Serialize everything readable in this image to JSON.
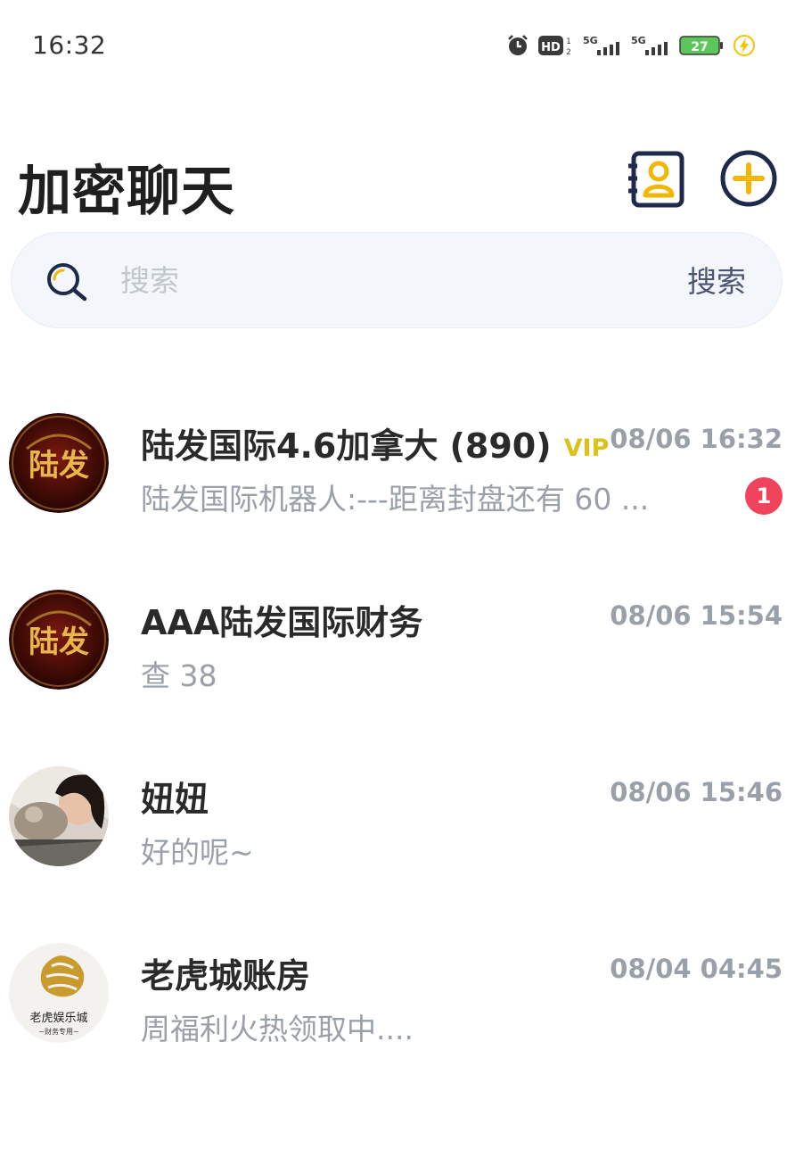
{
  "status_bar": {
    "time": "16:32",
    "icons": [
      "alarm-icon",
      "hd-icon",
      "signal-5g-icon",
      "signal-5g-icon",
      "battery-icon",
      "charging-icon"
    ],
    "hd_label": "HD",
    "network1": "5G",
    "network2": "5G",
    "battery_level": "27",
    "colors": {
      "battery": "#5dc65a",
      "charging": "#f5c400"
    }
  },
  "header": {
    "title": "加密聊天",
    "icons": [
      "contacts-icon",
      "add-icon"
    ],
    "colors": {
      "icon_frame": "#1e2a4a",
      "icon_accent": "#f2b705"
    }
  },
  "search": {
    "placeholder": "搜索",
    "button_label": "搜索",
    "icon": "search-icon"
  },
  "chats": [
    {
      "name": "陆发国际4.6加拿大 (890)",
      "badge": "VIP",
      "time": "08/06 16:32",
      "preview": "陆发国际机器人:---距离封盘还有 60 ...",
      "unread": "1",
      "avatar": "ludfa-logo-avatar",
      "avatar_text": "陆发"
    },
    {
      "name": "AAA陆发国际财务",
      "time": "08/06 15:54",
      "preview": "查 38",
      "avatar": "ludfa-logo-avatar",
      "avatar_text": "陆发"
    },
    {
      "name": "妞妞",
      "time": "08/06 15:46",
      "preview": "好的呢~",
      "avatar": "person-photo-avatar"
    },
    {
      "name": "老虎城账房",
      "time": "08/04 04:45",
      "preview": "周福利火热领取中....",
      "avatar": "tiger-city-logo-avatar",
      "avatar_text": "老虎娱乐城",
      "avatar_subtext": "~财务专用~"
    }
  ],
  "colors": {
    "unread_badge": "#f0445d",
    "vip": "#d9c21a",
    "muted_text": "#9aa0aa",
    "search_bg": "#f3f6fb"
  }
}
